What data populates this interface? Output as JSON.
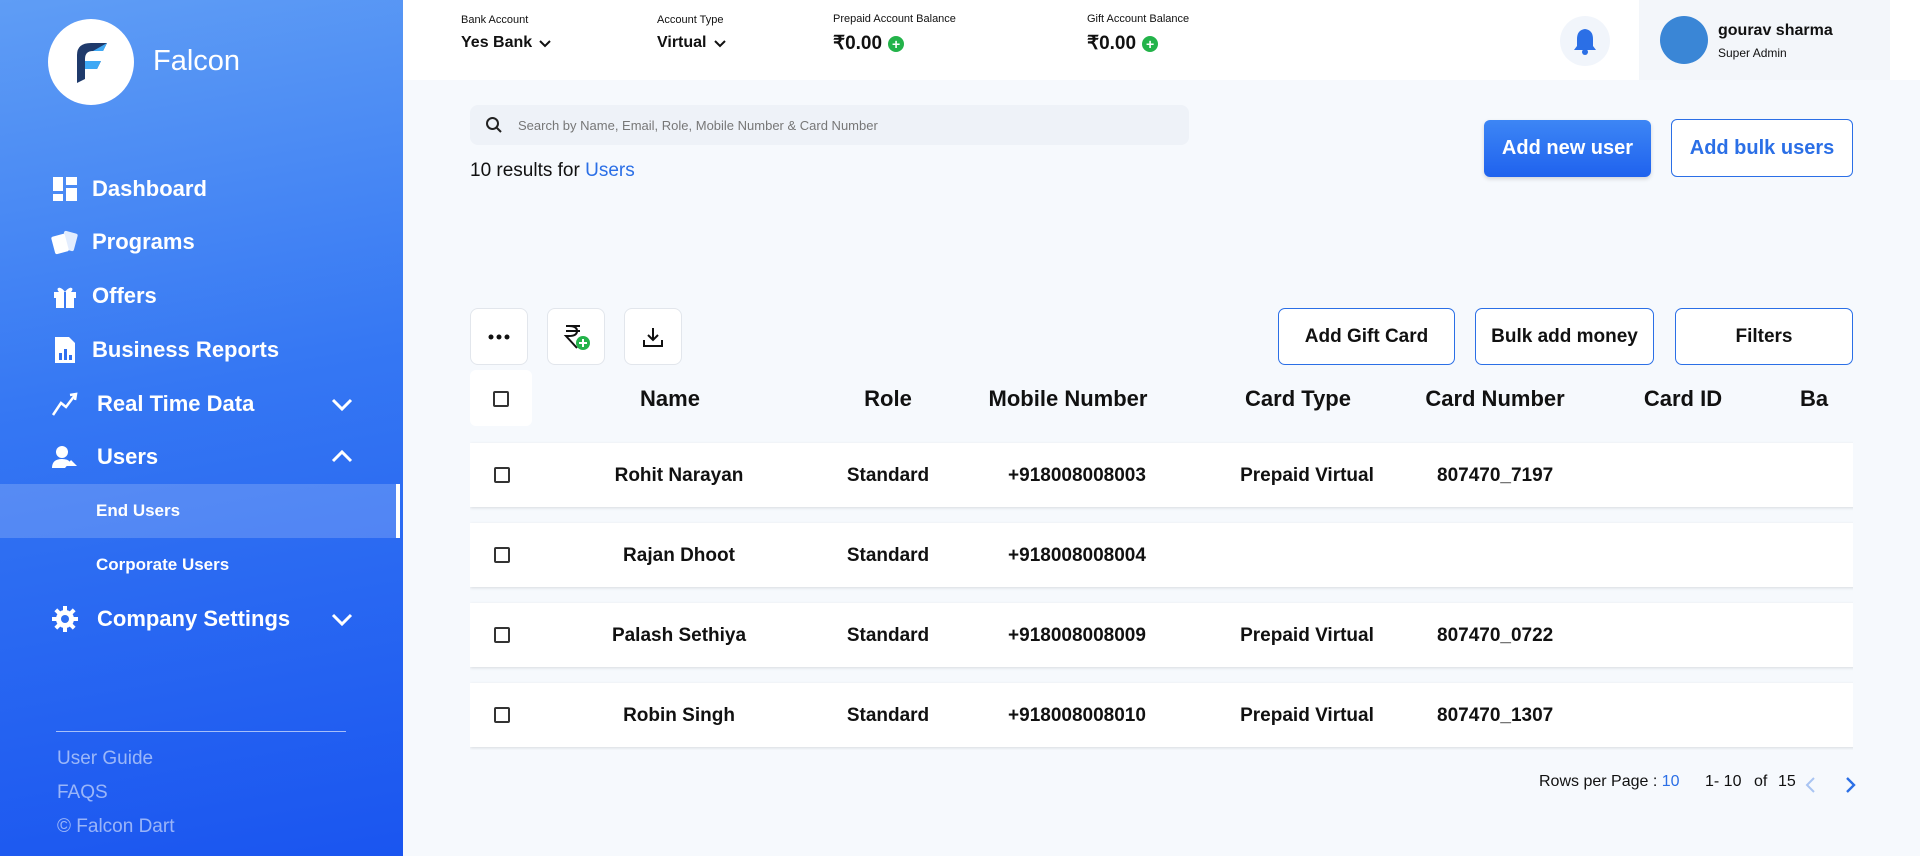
{
  "sidebar": {
    "brand": "Falcon",
    "nav": [
      {
        "label": "Dashboard",
        "icon": "dashboard-icon"
      },
      {
        "label": "Programs",
        "icon": "programs-icon"
      },
      {
        "label": "Offers",
        "icon": "gift-icon"
      },
      {
        "label": "Business Reports",
        "icon": "report-icon"
      },
      {
        "label": "Real Time Data",
        "icon": "realtime-icon"
      },
      {
        "label": "Users",
        "icon": "users-icon"
      },
      {
        "label": "End Users"
      },
      {
        "label": "Corporate Users"
      },
      {
        "label": "Company Settings",
        "icon": "gear-icon"
      }
    ],
    "footer": {
      "guide": "User Guide",
      "faqs": "FAQS",
      "copyright": "© Falcon Dart"
    }
  },
  "topbar": {
    "bank": {
      "label": "Bank Account",
      "value": "Yes Bank"
    },
    "type": {
      "label": "Account Type",
      "value": "Virtual"
    },
    "prepaid": {
      "label": "Prepaid Account Balance",
      "value": "₹0.00"
    },
    "gift": {
      "label": "Gift Account Balance",
      "value": "₹0.00"
    },
    "user": {
      "name": "gourav sharma",
      "role": "Super Admin"
    }
  },
  "main": {
    "search_placeholder": "Search by Name, Email, Role, Mobile Number & Card Number",
    "results_prefix": "10 results for",
    "results_entity": "Users",
    "add_user": "Add new user",
    "add_bulk": "Add bulk users",
    "add_gift_card": "Add Gift Card",
    "bulk_add_money": "Bulk add money",
    "filters": "Filters"
  },
  "table": {
    "columns": [
      "Name",
      "Role",
      "Mobile Number",
      "Card Type",
      "Card Number",
      "Card ID",
      "Ba"
    ],
    "rows": [
      {
        "name": "Rohit Narayan",
        "role": "Standard",
        "mobile": "+918008008003",
        "card_type": "Prepaid Virtual",
        "card_number": "807470_7197"
      },
      {
        "name": "Rajan Dhoot",
        "role": "Standard",
        "mobile": "+918008008004",
        "card_type": "",
        "card_number": ""
      },
      {
        "name": "Palash Sethiya",
        "role": "Standard",
        "mobile": "+918008008009",
        "card_type": "Prepaid Virtual",
        "card_number": "807470_0722"
      },
      {
        "name": "Robin Singh",
        "role": "Standard",
        "mobile": "+918008008010",
        "card_type": "Prepaid Virtual",
        "card_number": "807470_1307"
      }
    ]
  },
  "pagination": {
    "rows_label": "Rows per Page :",
    "rows_value": "10",
    "range": "1- 10",
    "of": "of",
    "total": "15"
  },
  "colors": {
    "accent": "#2b6fe6",
    "sidebar_top": "#5f9df5",
    "sidebar_bottom": "#1a55f0",
    "success": "#23b34a"
  }
}
